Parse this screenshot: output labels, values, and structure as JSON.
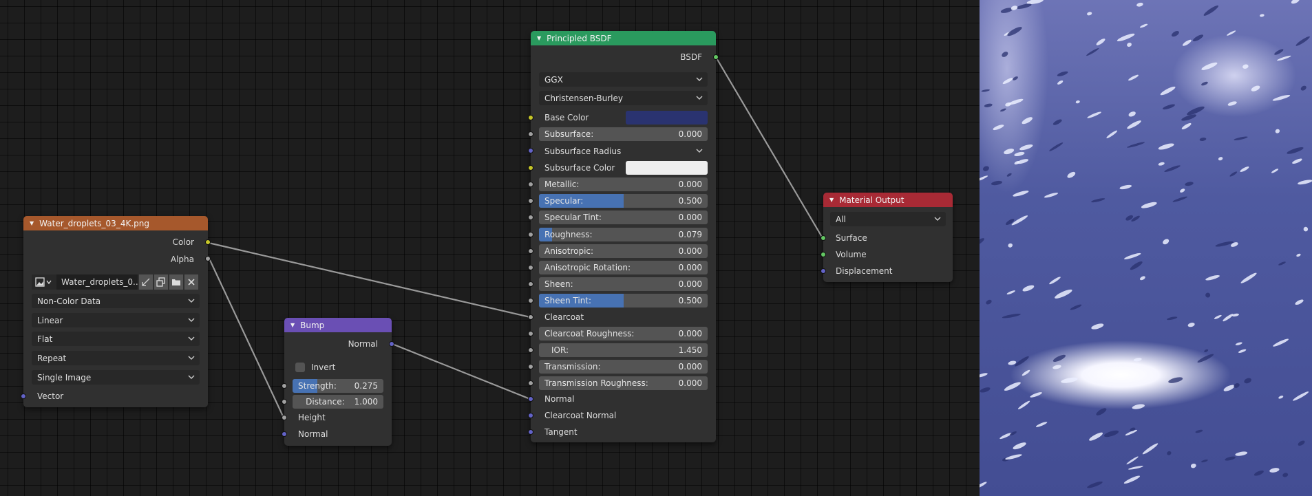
{
  "image_node": {
    "title": "Water_droplets_03_4K.png",
    "outputs": [
      "Color",
      "Alpha"
    ],
    "image_name": "Water_droplets_0..",
    "color_space": "Non-Color Data",
    "interpolation": "Linear",
    "projection": "Flat",
    "extension": "Repeat",
    "source": "Single Image",
    "input": "Vector"
  },
  "bump_node": {
    "title": "Bump",
    "output": "Normal",
    "invert_label": "Invert",
    "strength_label": "Strength:",
    "strength_value": "0.275",
    "strength_fraction": 0.275,
    "distance_label": "Distance:",
    "distance_value": "1.000",
    "inputs": [
      "Height",
      "Normal"
    ]
  },
  "bsdf_node": {
    "title": "Principled BSDF",
    "output": "BSDF",
    "distribution": "GGX",
    "subsurface_method": "Christensen-Burley",
    "base_color_label": "Base Color",
    "base_color": "#2a3370",
    "subsurface_label": "Subsurface:",
    "subsurface_value": "0.000",
    "subsurface_radius_label": "Subsurface Radius",
    "subsurface_color_label": "Subsurface Color",
    "subsurface_color": "#eeeeee",
    "metallic_label": "Metallic:",
    "metallic_value": "0.000",
    "specular_label": "Specular:",
    "specular_value": "0.500",
    "specular_fraction": 0.5,
    "specular_tint_label": "Specular Tint:",
    "specular_tint_value": "0.000",
    "roughness_label": "Roughness:",
    "roughness_value": "0.079",
    "roughness_fraction": 0.079,
    "anisotropic_label": "Anisotropic:",
    "anisotropic_value": "0.000",
    "anisotropic_rotation_label": "Anisotropic Rotation:",
    "anisotropic_rotation_value": "0.000",
    "sheen_label": "Sheen:",
    "sheen_value": "0.000",
    "sheen_tint_label": "Sheen Tint:",
    "sheen_tint_value": "0.500",
    "sheen_tint_fraction": 0.5,
    "clearcoat_label": "Clearcoat",
    "clearcoat_roughness_label": "Clearcoat Roughness:",
    "clearcoat_roughness_value": "0.000",
    "ior_label": "IOR:",
    "ior_value": "1.450",
    "transmission_label": "Transmission:",
    "transmission_value": "0.000",
    "transmission_roughness_label": "Transmission Roughness:",
    "transmission_roughness_value": "0.000",
    "normal_label": "Normal",
    "clearcoat_normal_label": "Clearcoat Normal",
    "tangent_label": "Tangent"
  },
  "output_node": {
    "title": "Material Output",
    "target": "All",
    "inputs": [
      "Surface",
      "Volume",
      "Displacement"
    ]
  },
  "colors": {
    "image_header": "#a6582c",
    "bump_header": "#6a4fb4",
    "bsdf_header": "#2a9a5e",
    "output_header": "#a82a35",
    "slider_fill": "#4772b3"
  }
}
